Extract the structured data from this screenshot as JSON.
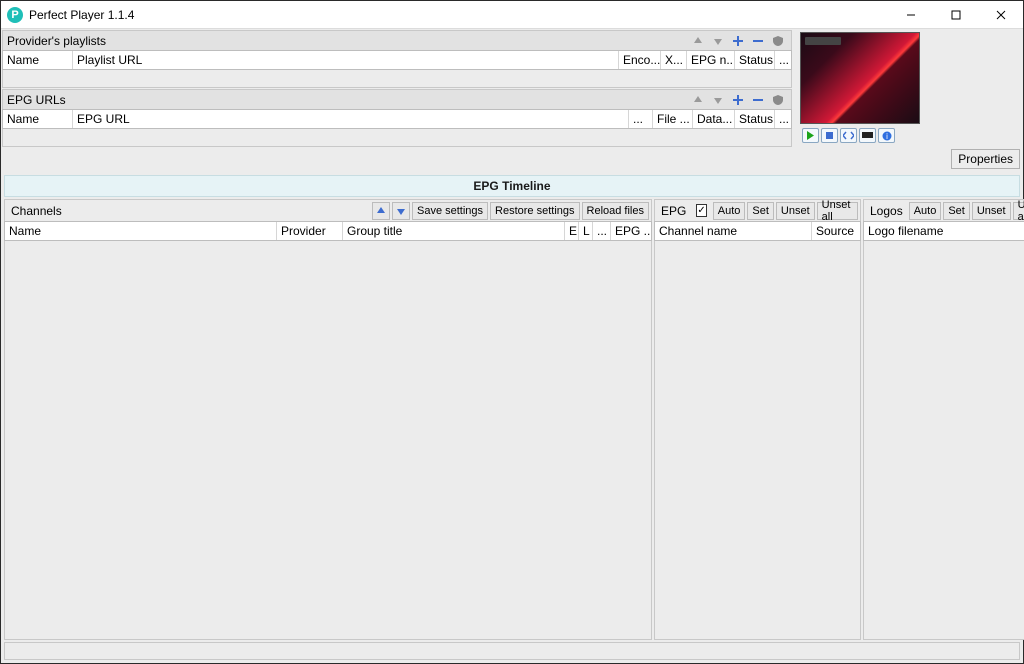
{
  "window": {
    "title": "Perfect Player 1.1.4"
  },
  "playlists_panel": {
    "title": "Provider's playlists",
    "cols": {
      "name": "Name",
      "url": "Playlist URL",
      "enco": "Enco...",
      "x": "X...",
      "epg": "EPG n...",
      "status": "Status",
      "more": "..."
    }
  },
  "epg_panel": {
    "title": "EPG URLs",
    "cols": {
      "name": "Name",
      "url": "EPG URL",
      "more1": "...",
      "file": "File ...",
      "data": "Data...",
      "status": "Status",
      "more2": "..."
    }
  },
  "timeline": {
    "title": "EPG Timeline"
  },
  "channels": {
    "title": "Channels",
    "buttons": {
      "save": "Save settings",
      "restore": "Restore settings",
      "reload": "Reload files"
    },
    "cols": {
      "name": "Name",
      "provider": "Provider",
      "group": "Group title",
      "e": "E",
      "l": "L",
      "dots": "...",
      "epg": "EPG ..."
    }
  },
  "epg_col": {
    "title": "EPG",
    "buttons": {
      "auto": "Auto",
      "set": "Set",
      "unset": "Unset",
      "unset_all": "Unset all"
    },
    "cols": {
      "channel": "Channel name",
      "source": "Source"
    }
  },
  "logos_col": {
    "title": "Logos",
    "buttons": {
      "auto": "Auto",
      "set": "Set",
      "unset": "Unset",
      "unset_all": "Unset all"
    },
    "cols": {
      "filename": "Logo filename"
    }
  },
  "properties_btn": "Properties"
}
